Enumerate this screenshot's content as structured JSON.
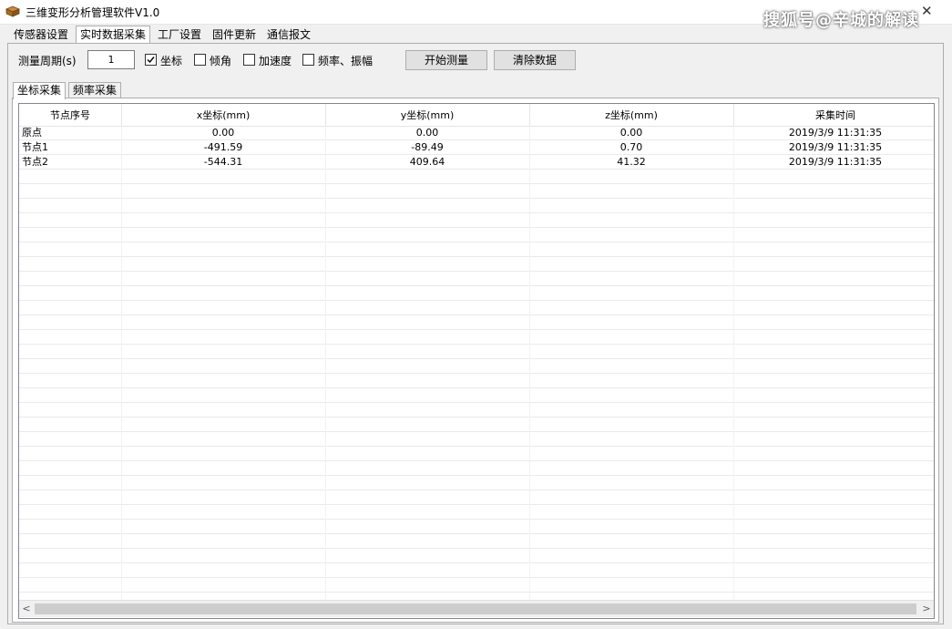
{
  "window": {
    "title": "三维变形分析管理软件V1.0",
    "watermark": "搜狐号@辛城的解读",
    "close_label": "✕"
  },
  "menu": {
    "tabs": [
      {
        "label": "传感器设置"
      },
      {
        "label": "实时数据采集"
      },
      {
        "label": "工厂设置"
      },
      {
        "label": "固件更新"
      },
      {
        "label": "通信报文"
      }
    ],
    "active": "实时数据采集"
  },
  "controls": {
    "period_label": "测量周期(s)",
    "period_value": "1",
    "checkboxes": [
      {
        "label": "坐标",
        "checked": true
      },
      {
        "label": "倾角",
        "checked": false
      },
      {
        "label": "加速度",
        "checked": false
      },
      {
        "label": "频率、振幅",
        "checked": false
      }
    ],
    "start_button": "开始测量",
    "clear_button": "清除数据"
  },
  "subtabs": [
    {
      "label": "坐标采集"
    },
    {
      "label": "频率采集"
    }
  ],
  "table": {
    "columns": [
      "节点序号",
      "x坐标(mm)",
      "y坐标(mm)",
      "z坐标(mm)",
      "采集时间"
    ],
    "rows": [
      [
        "原点",
        "0.00",
        "0.00",
        "0.00",
        "2019/3/9 11:31:35"
      ],
      [
        "节点1",
        "-491.59",
        "-89.49",
        "0.70",
        "2019/3/9 11:31:35"
      ],
      [
        "节点2",
        "-544.31",
        "409.64",
        "41.32",
        "2019/3/9 11:31:35"
      ]
    ]
  },
  "scrollbar": {
    "left_arrow": "<",
    "right_arrow": ">"
  }
}
